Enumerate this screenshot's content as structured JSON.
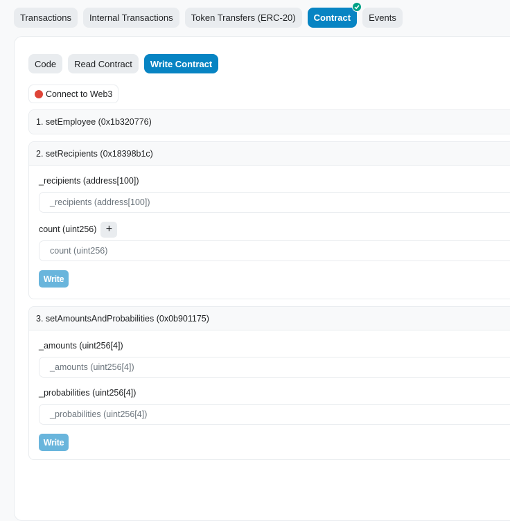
{
  "tabs": [
    {
      "label": "Transactions",
      "active": false
    },
    {
      "label": "Internal Transactions",
      "active": false
    },
    {
      "label": "Token Transfers (ERC-20)",
      "active": false
    },
    {
      "label": "Contract",
      "active": true,
      "badge": "check-icon"
    },
    {
      "label": "Events",
      "active": false
    }
  ],
  "subtabs": [
    {
      "label": "Code",
      "active": false
    },
    {
      "label": "Read Contract",
      "active": false
    },
    {
      "label": "Write Contract",
      "active": true
    }
  ],
  "connect": {
    "label": "Connect to Web3",
    "status_color": "#de4437"
  },
  "functions": [
    {
      "title": "1. setEmployee (0x1b320776)",
      "expanded": false
    },
    {
      "title": "2. setRecipients (0x18398b1c)",
      "expanded": true,
      "params": [
        {
          "label": "_recipients (address[100])",
          "placeholder": "_recipients (address[100])",
          "has_add": false
        },
        {
          "label": "count (uint256)",
          "placeholder": "count (uint256)",
          "has_add": true,
          "add_label": "+"
        }
      ],
      "write_label": "Write"
    },
    {
      "title": "3. setAmountsAndProbabilities (0x0b901175)",
      "expanded": true,
      "params": [
        {
          "label": "_amounts (uint256[4])",
          "placeholder": "_amounts (uint256[4])",
          "has_add": false
        },
        {
          "label": "_probabilities (uint256[4])",
          "placeholder": "_probabilities (uint256[4])",
          "has_add": false
        }
      ],
      "write_label": "Write"
    }
  ],
  "colors": {
    "accent": "#0784c3",
    "write_disabled": "#69b5dc",
    "verified": "#00a186"
  }
}
